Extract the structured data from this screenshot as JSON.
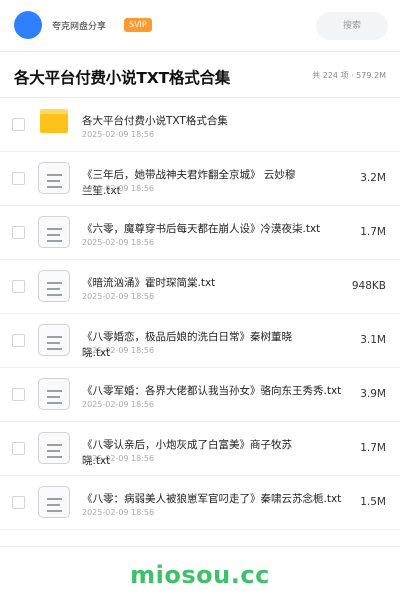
{
  "header": {
    "user_name": "夸克网盘分享",
    "badge": "SVIP",
    "search_placeholder": "搜索"
  },
  "title_bar": {
    "title": "各大平台付费小说TXT格式合集",
    "summary": "共 224 项 · 579.2M"
  },
  "items": [
    {
      "type": "folder",
      "name": "各大平台付费小说TXT格式合集",
      "date": "2025-02-09 18:56",
      "size": ""
    },
    {
      "type": "file",
      "name": "《三年后，她带战神夫君炸翻全京城》 云妙穆兰笙.txt",
      "date": "2025-02-09 18:56",
      "size": "3.2M",
      "wrap": true
    },
    {
      "type": "file",
      "name": "《六零，魔尊穿书后每天都在崩人设》冷漠夜柒.txt",
      "date": "2025-02-09 18:56",
      "size": "1.7M"
    },
    {
      "type": "file",
      "name": "《暗流汹涌》霍时琛简棠.txt",
      "date": "2025-02-09 18:56",
      "size": "948KB"
    },
    {
      "type": "file",
      "name": "《八零婚恋，极品后娘的洗白日常》秦树董晓晓.txt",
      "date": "2025-02-09 18:56",
      "size": "3.1M",
      "wrap": true
    },
    {
      "type": "file",
      "name": "《八零军婚：各界大佬都认我当孙女》骆向东王秀秀.txt",
      "date": "2025-02-09 18:56",
      "size": "3.9M",
      "ellip": true
    },
    {
      "type": "file",
      "name": "《八零认亲后，小炮灰成了白富美》商子牧苏晓.txt",
      "date": "2025-02-09 18:56",
      "size": "1.7M",
      "wrap": true
    },
    {
      "type": "file",
      "name": "《八零：病弱美人被狼崽军官叼走了》秦啸云苏念栀.txt",
      "date": "2025-02-09 18:56",
      "size": "1.5M",
      "ellip": true
    }
  ],
  "footer": {
    "watermark": "miosou.cc"
  },
  "colors": {
    "accent": "#2f80ff",
    "badge": "#ff9a2e",
    "folder": "#ffc21a",
    "watermark": "#3ec16a"
  }
}
